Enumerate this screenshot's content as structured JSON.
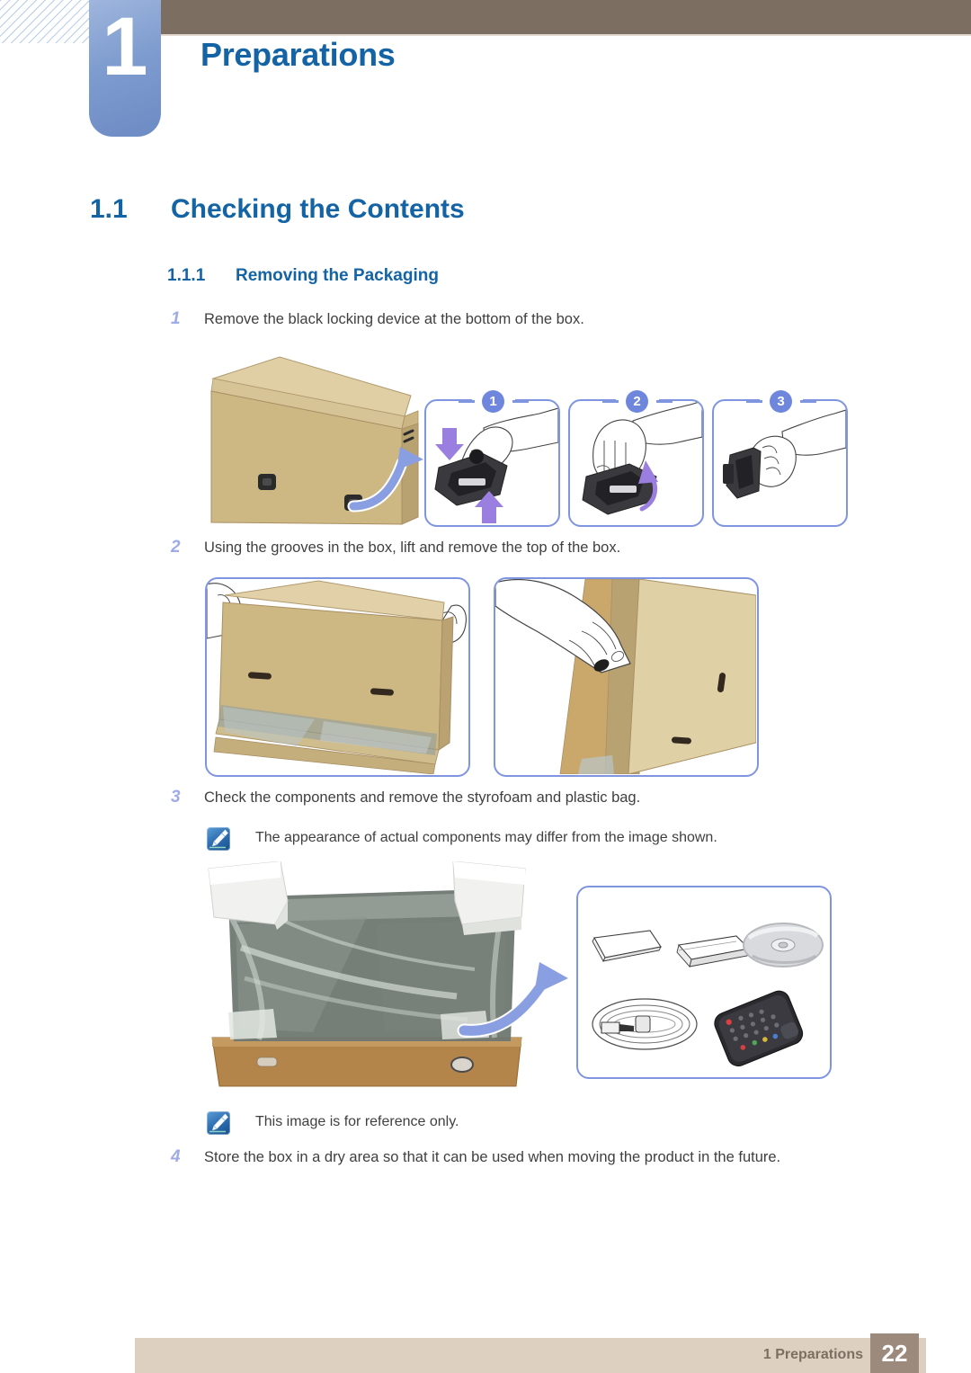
{
  "header": {
    "chapter_number": "1",
    "chapter_title": "Preparations"
  },
  "headings": {
    "h1_number": "1.1",
    "h1_title": "Checking the Contents",
    "h2_number": "1.1.1",
    "h2_title": "Removing the Packaging"
  },
  "steps": [
    {
      "number": "1",
      "text": "Remove the black locking device at the bottom of the box."
    },
    {
      "number": "2",
      "text": "Using the grooves in the box, lift and remove the top of the box."
    },
    {
      "number": "3",
      "text": "Check the components and remove the styrofoam and plastic bag."
    },
    {
      "number": "4",
      "text": "Store the box in a dry area so that it can be used when moving the product in the future."
    }
  ],
  "notes": [
    {
      "icon": "note-pencil-icon",
      "text": "The appearance of actual components may differ from the image shown."
    },
    {
      "icon": "note-pencil-icon",
      "text": "This image is for reference only."
    }
  ],
  "figures": {
    "step1_panels": [
      {
        "badge": "1",
        "caption": "hand pressing black locking device"
      },
      {
        "badge": "2",
        "caption": "hand lifting black locking device"
      },
      {
        "badge": "3",
        "caption": "hand holding removed locking device"
      }
    ],
    "step2_panels": [
      {
        "caption": "hands lifting top of box"
      },
      {
        "caption": "hand gripping groove of box"
      }
    ],
    "step3_panels": [
      {
        "caption": "monitor wrapped in plastic with styrofoam in box"
      },
      {
        "caption": "accessories: quick setup guide, warranty card, software CD, power cable, remote control"
      }
    ]
  },
  "footer": {
    "section_label": "1 Preparations",
    "page_number": "22"
  },
  "colors": {
    "heading_blue": "#1464a5",
    "chapter_badge_blue": "#7e9ccf",
    "panel_border": "#8095e0",
    "badge_circle": "#6f86dd",
    "step_number": "#9fabe4",
    "header_brown": "#7c6e61",
    "footer_bar": "#ddd0c1",
    "footer_page_box": "#9c8a7c",
    "body_text": "#3f3f3f",
    "arrow_blue": "#7f97e0"
  }
}
